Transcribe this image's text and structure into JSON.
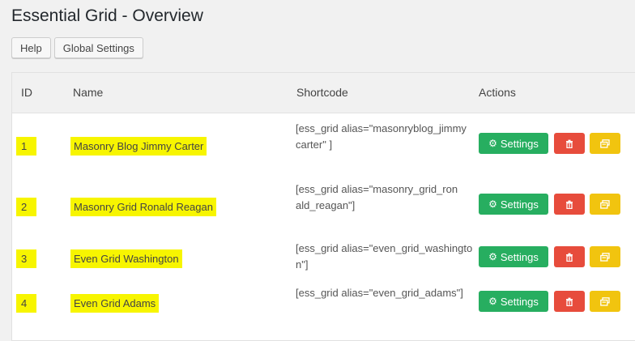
{
  "page": {
    "title": "Essential Grid - Overview"
  },
  "toolbar": {
    "help_label": "Help",
    "global_settings_label": "Global Settings"
  },
  "table": {
    "headers": {
      "id": "ID",
      "name": "Name",
      "shortcode": "Shortcode",
      "actions": "Actions"
    },
    "rows": [
      {
        "id": "1",
        "name": "Masonry Blog Jimmy Carter",
        "shortcode": "[ess_grid alias=\"masonryblog_jimmycarter\" ]"
      },
      {
        "id": "2",
        "name": "Masonry Grid Ronald Reagan",
        "shortcode": "[ess_grid alias=\"masonry_grid_ronald_reagan\"]"
      },
      {
        "id": "3",
        "name": "Even Grid Washington",
        "shortcode": "[ess_grid alias=\"even_grid_washington\"]"
      },
      {
        "id": "4",
        "name": "Even Grid Adams",
        "shortcode": "[ess_grid alias=\"even_grid_adams\"]"
      }
    ],
    "action_labels": {
      "settings": "Settings"
    }
  },
  "colors": {
    "settings": "#27ae60",
    "delete": "#e74c3c",
    "duplicate": "#f1c40f",
    "highlight": "#f7f500"
  },
  "icons": {
    "settings": "gear-icon",
    "delete": "trash-icon",
    "duplicate": "duplicate-icon"
  }
}
